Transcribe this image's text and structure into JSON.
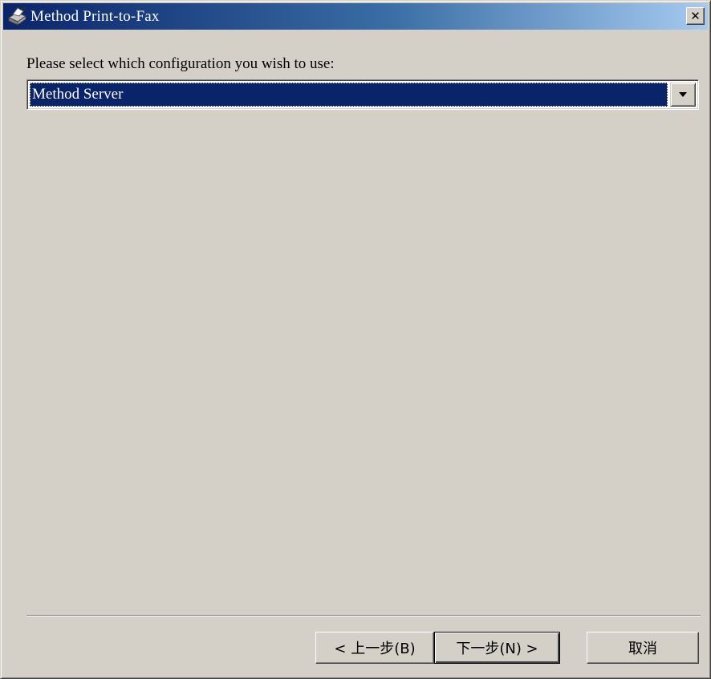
{
  "window": {
    "title": "Method Print-to-Fax",
    "icon": "fax-printer-icon",
    "close_label": "✕"
  },
  "prompt": "Please select which configuration you wish to use:",
  "configuration_select": {
    "selected": "Method Server"
  },
  "buttons": {
    "back": "< 上一步(B)",
    "next": "下一步(N) >",
    "cancel": "取消"
  },
  "colors": {
    "face": "#d4d0c8",
    "title_start": "#0a246a",
    "title_end": "#a6caf0",
    "selection": "#0a246a"
  }
}
